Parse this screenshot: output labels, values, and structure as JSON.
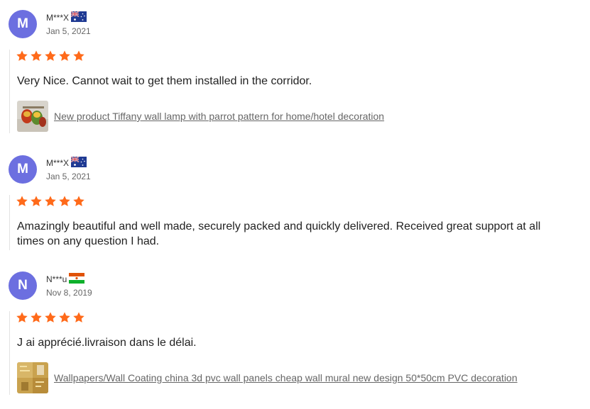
{
  "colors": {
    "avatar_bg": "#6c6fe0",
    "star": "#ff6a1a",
    "link": "#666666",
    "divider": "#e3e3e3"
  },
  "reviews": [
    {
      "initial": "M",
      "name": "M***X",
      "flag": "australia-flag-icon",
      "date": "Jan 5, 2021",
      "rating": 5,
      "text": "Very Nice. Cannot wait to get them installed in the corridor.",
      "product": {
        "thumb": "parrot-lamp-thumbnail",
        "title": "New product Tiffany wall lamp with parrot pattern for home/hotel decoration"
      }
    },
    {
      "initial": "M",
      "name": "M***X",
      "flag": "australia-flag-icon",
      "date": "Jan 5, 2021",
      "rating": 5,
      "text": "Amazingly beautiful and well made, securely packed and quickly delivered. Received great support at all times on any question I had."
    },
    {
      "initial": "N",
      "name": "N***u",
      "flag": "niger-flag-icon",
      "date": "Nov 8, 2019",
      "rating": 5,
      "text": "J ai apprécié.livraison dans le délai.",
      "product": {
        "thumb": "wall-panel-thumbnail",
        "title": "Wallpapers/Wall Coating china 3d pvc wall panels cheap wall mural new design 50*50cm PVC decoration"
      }
    }
  ]
}
